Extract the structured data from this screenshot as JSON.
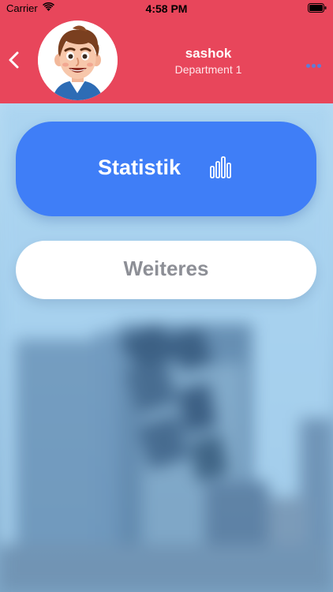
{
  "status_bar": {
    "carrier": "Carrier",
    "time": "4:58 PM",
    "wifi_icon": "wifi-icon",
    "battery_icon": "battery-icon"
  },
  "header": {
    "background_color": "#e8465b",
    "back_icon": "chevron-left-icon",
    "avatar_icon": "cartoon-avatar",
    "user_name": "sashok",
    "department": "Department 1",
    "more_icon": "ellipsis-icon"
  },
  "menu": {
    "statistik": {
      "label": "Statistik",
      "icon": "bar-chart-icon",
      "color": "#3f7ef7"
    },
    "weiteres": {
      "label": "Weiteres",
      "color": "#ffffff"
    }
  }
}
